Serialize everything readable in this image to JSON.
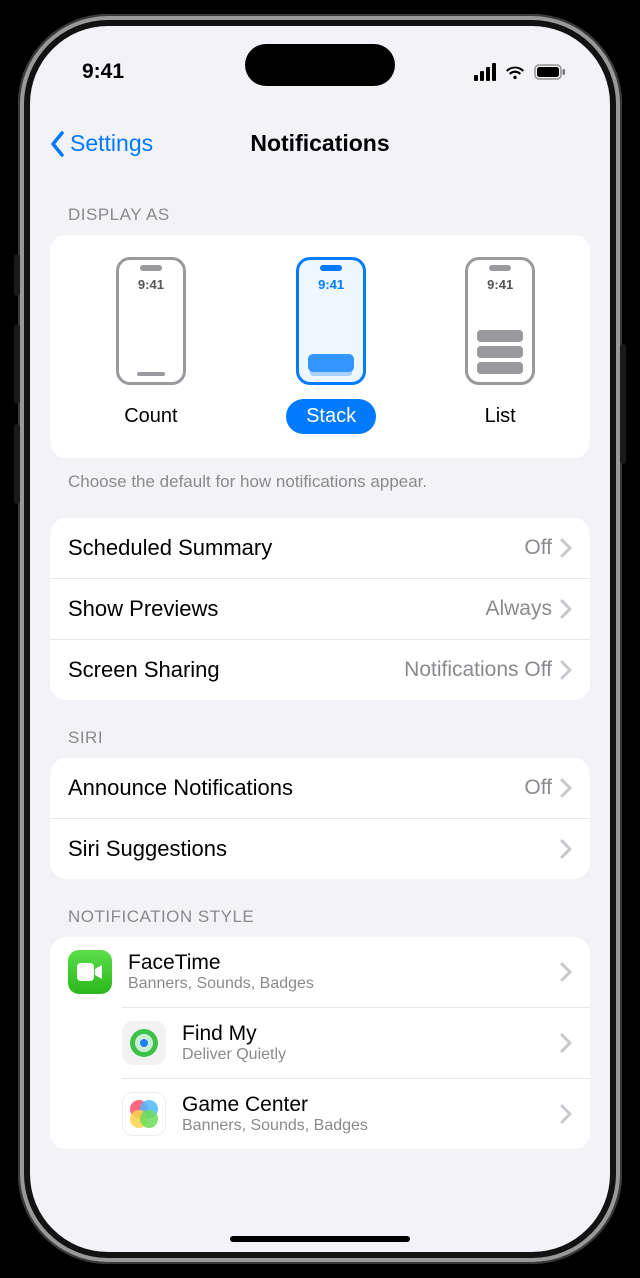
{
  "status": {
    "time": "9:41"
  },
  "nav": {
    "back": "Settings",
    "title": "Notifications"
  },
  "displayAs": {
    "header": "DISPLAY AS",
    "options": [
      {
        "label": "Count",
        "previewTime": "9:41"
      },
      {
        "label": "Stack",
        "previewTime": "9:41"
      },
      {
        "label": "List",
        "previewTime": "9:41"
      }
    ],
    "selectedIndex": 1,
    "footer": "Choose the default for how notifications appear."
  },
  "general": [
    {
      "label": "Scheduled Summary",
      "value": "Off"
    },
    {
      "label": "Show Previews",
      "value": "Always"
    },
    {
      "label": "Screen Sharing",
      "value": "Notifications Off"
    }
  ],
  "siri": {
    "header": "SIRI",
    "rows": [
      {
        "label": "Announce Notifications",
        "value": "Off"
      },
      {
        "label": "Siri Suggestions",
        "value": ""
      }
    ]
  },
  "style": {
    "header": "NOTIFICATION STYLE",
    "apps": [
      {
        "name": "FaceTime",
        "sub": "Banners, Sounds, Badges"
      },
      {
        "name": "Find My",
        "sub": "Deliver Quietly"
      },
      {
        "name": "Game Center",
        "sub": "Banners, Sounds, Badges"
      }
    ]
  }
}
